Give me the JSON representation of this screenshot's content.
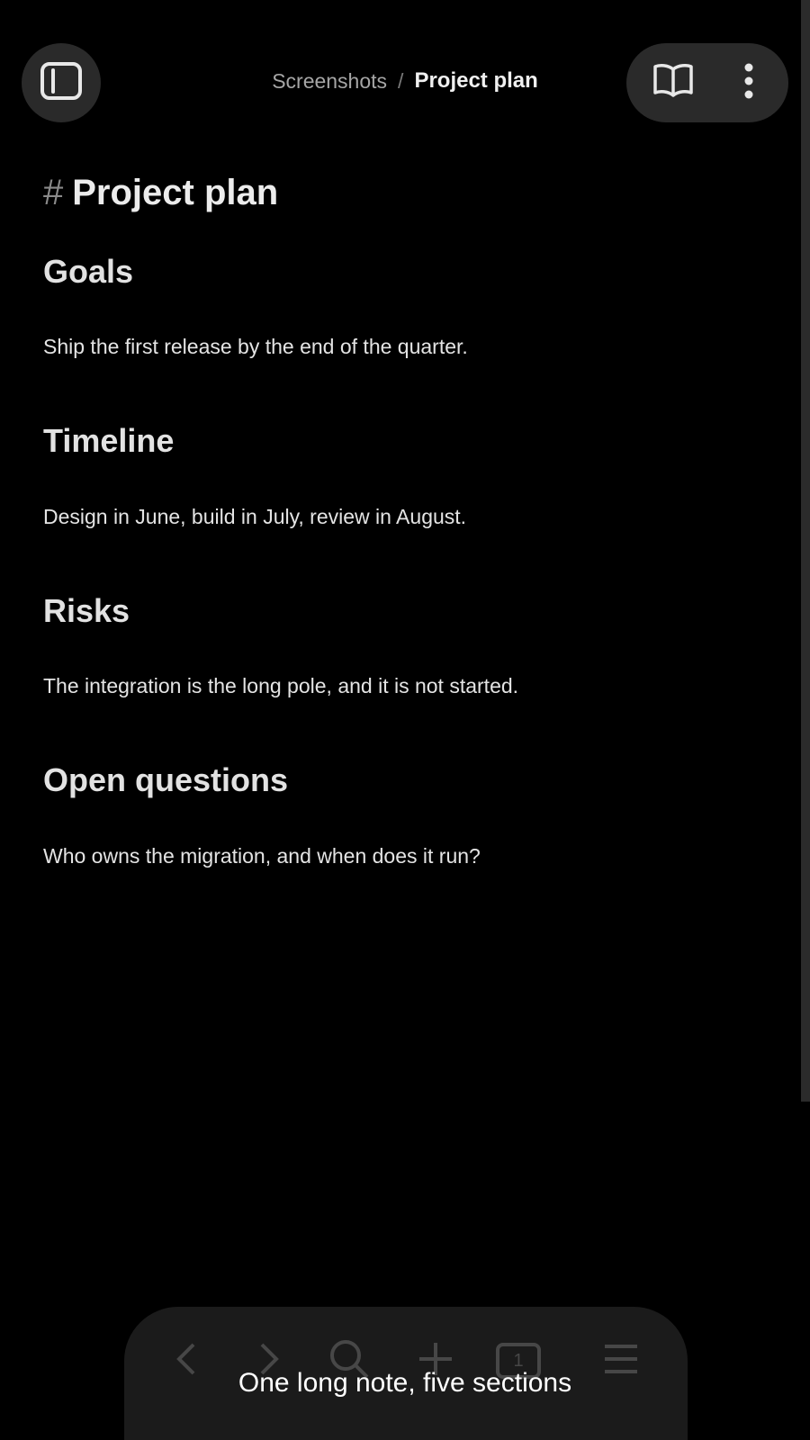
{
  "header": {
    "breadcrumb_parent": "Screenshots",
    "breadcrumb_separator": "/",
    "breadcrumb_current": "Project plan"
  },
  "note": {
    "title_marker": "#",
    "title": "Project plan",
    "sections": [
      {
        "heading": "Goals",
        "text": "Ship the first release by the end of the quarter."
      },
      {
        "heading": "Timeline",
        "text": "Design in June, build in July, review in August."
      },
      {
        "heading": "Risks",
        "text": "The integration is the long pole, and it is not started."
      },
      {
        "heading": "Open questions",
        "text": "Who owns the migration, and when does it run?"
      }
    ]
  },
  "toolbar": {
    "tabs_count": "1",
    "icons": [
      "back-icon",
      "forward-icon",
      "search-icon",
      "plus-icon",
      "tabs-icon",
      "menu-icon"
    ]
  },
  "caption": "One long note, five sections",
  "colors": {
    "background": "#000000",
    "button_bg": "#2a2a2a",
    "text": "#e6e6e6",
    "muted": "#a6a6a6"
  }
}
